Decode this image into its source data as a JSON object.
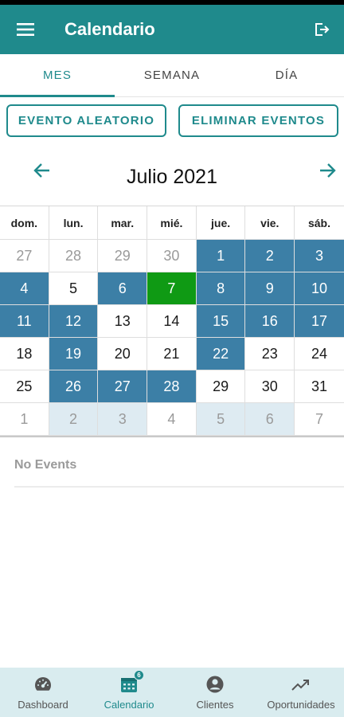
{
  "header": {
    "title": "Calendario",
    "menu_icon": "hamburger-menu-icon",
    "logout_icon": "logout-icon"
  },
  "tabs": [
    {
      "label": "MES",
      "active": true
    },
    {
      "label": "SEMANA",
      "active": false
    },
    {
      "label": "DÍA",
      "active": false
    }
  ],
  "actions": {
    "random_event_label": "EVENTO ALEATORIO",
    "delete_events_label": "ELIMINAR EVENTOS"
  },
  "calendar": {
    "month_title": "Julio 2021",
    "weekdays": [
      "dom.",
      "lun.",
      "mar.",
      "mié.",
      "jue.",
      "vie.",
      "sáb."
    ],
    "weeks": [
      [
        {
          "day": "27",
          "state": "muted"
        },
        {
          "day": "28",
          "state": "muted"
        },
        {
          "day": "29",
          "state": "muted"
        },
        {
          "day": "30",
          "state": "muted"
        },
        {
          "day": "1",
          "state": "event"
        },
        {
          "day": "2",
          "state": "event"
        },
        {
          "day": "3",
          "state": "event"
        }
      ],
      [
        {
          "day": "4",
          "state": "event"
        },
        {
          "day": "5",
          "state": "normal"
        },
        {
          "day": "6",
          "state": "event"
        },
        {
          "day": "7",
          "state": "today"
        },
        {
          "day": "8",
          "state": "event"
        },
        {
          "day": "9",
          "state": "event"
        },
        {
          "day": "10",
          "state": "event"
        }
      ],
      [
        {
          "day": "11",
          "state": "event"
        },
        {
          "day": "12",
          "state": "event"
        },
        {
          "day": "13",
          "state": "normal"
        },
        {
          "day": "14",
          "state": "normal"
        },
        {
          "day": "15",
          "state": "event"
        },
        {
          "day": "16",
          "state": "event"
        },
        {
          "day": "17",
          "state": "event"
        }
      ],
      [
        {
          "day": "18",
          "state": "normal"
        },
        {
          "day": "19",
          "state": "event"
        },
        {
          "day": "20",
          "state": "normal"
        },
        {
          "day": "21",
          "state": "normal"
        },
        {
          "day": "22",
          "state": "event"
        },
        {
          "day": "23",
          "state": "normal"
        },
        {
          "day": "24",
          "state": "normal"
        }
      ],
      [
        {
          "day": "25",
          "state": "normal"
        },
        {
          "day": "26",
          "state": "event"
        },
        {
          "day": "27",
          "state": "event"
        },
        {
          "day": "28",
          "state": "event"
        },
        {
          "day": "29",
          "state": "normal"
        },
        {
          "day": "30",
          "state": "normal"
        },
        {
          "day": "31",
          "state": "normal"
        }
      ],
      [
        {
          "day": "1",
          "state": "muted"
        },
        {
          "day": "2",
          "state": "muted-event"
        },
        {
          "day": "3",
          "state": "muted-event"
        },
        {
          "day": "4",
          "state": "muted"
        },
        {
          "day": "5",
          "state": "muted-event"
        },
        {
          "day": "6",
          "state": "muted-event"
        },
        {
          "day": "7",
          "state": "muted"
        }
      ]
    ],
    "colors": {
      "event": "#3c7fa6",
      "today": "#0f9a14",
      "muted_event": "#deebf2",
      "accent": "#1f8a8c"
    }
  },
  "events_panel": {
    "empty_text": "No Events"
  },
  "bottom_nav": [
    {
      "label": "Dashboard",
      "icon": "speedometer-icon",
      "active": false
    },
    {
      "label": "Calendario",
      "icon": "calendar-icon",
      "active": true,
      "badge": "6"
    },
    {
      "label": "Clientes",
      "icon": "account-circle-icon",
      "active": false
    },
    {
      "label": "Oportunidades",
      "icon": "trending-up-icon",
      "active": false
    }
  ]
}
